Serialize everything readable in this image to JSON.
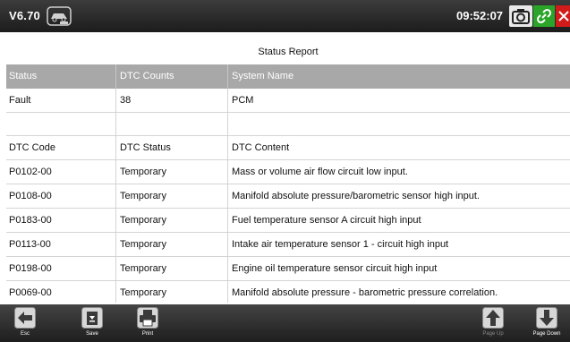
{
  "topbar": {
    "version": "V6.70",
    "time": "09:52:07",
    "icons": [
      "vehicle-vin-icon",
      "camera-icon",
      "link-icon",
      "close-icon"
    ],
    "colors": {
      "link_bg": "#2aa52a",
      "close_bg": "#d21b1b"
    }
  },
  "report": {
    "title": "Status Report",
    "summary_headers": [
      "Status",
      "DTC Counts",
      "System Name"
    ],
    "summary_rows": [
      [
        "Fault",
        "38",
        "PCM"
      ]
    ],
    "dtc_headers": [
      "DTC Code",
      "DTC Status",
      "DTC Content"
    ],
    "dtc_rows": [
      [
        "P0102-00",
        "Temporary",
        "Mass or volume air flow circuit low input."
      ],
      [
        "P0108-00",
        "Temporary",
        "Manifold absolute pressure/barometric sensor high input."
      ],
      [
        "P0183-00",
        "Temporary",
        "Fuel temperature sensor A circuit high input"
      ],
      [
        "P0113-00",
        "Temporary",
        "Intake air temperature sensor 1 - circuit high input"
      ],
      [
        "P0198-00",
        "Temporary",
        "Engine oil temperature sensor circuit high input"
      ],
      [
        "P0069-00",
        "Temporary",
        "Manifold absolute pressure - barometric pressure correlation."
      ]
    ]
  },
  "toolbar": {
    "esc_label": "Esc",
    "save_label": "Save",
    "print_label": "Print",
    "page_up_label": "Page Up",
    "page_down_label": "Page Down"
  }
}
